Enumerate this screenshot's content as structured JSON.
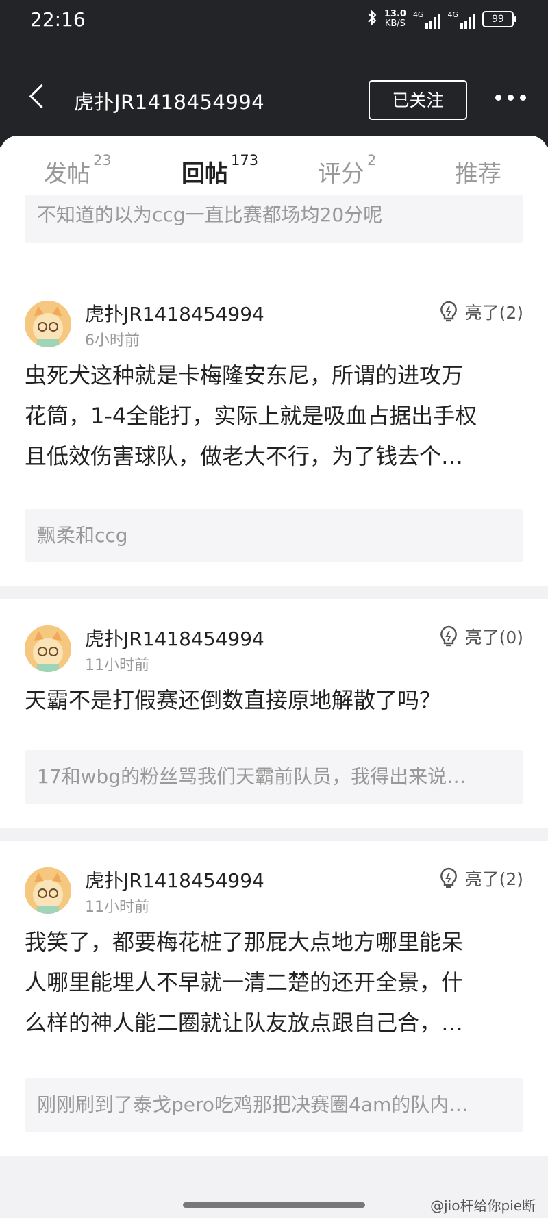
{
  "status": {
    "time": "22:16",
    "net_speed": "13.0",
    "net_unit": "KB/S",
    "signal1": "4G",
    "signal2": "4G",
    "battery": "99"
  },
  "nav": {
    "title": "虎扑JR1418454994",
    "follow_label": "已关注"
  },
  "tabs": [
    {
      "label": "发帖",
      "count": "23"
    },
    {
      "label": "回帖",
      "count": "173"
    },
    {
      "label": "评分",
      "count": "2"
    },
    {
      "label": "推荐",
      "count": ""
    }
  ],
  "top_quote": "不知道的以为ccg一直比赛都场均20分呢",
  "posts": [
    {
      "user": "虎扑JR1418454994",
      "time": "6小时前",
      "likes": "亮了(2)",
      "lines": [
        "虫死犬这种就是卡梅隆安东尼，所谓的进攻万",
        "花筒，1-4全能打，实际上就是吸血占据出手权",
        "且低效伤害球队，做老大不行，为了钱去个…"
      ],
      "quote": "飘柔和ccg"
    },
    {
      "user": "虎扑JR1418454994",
      "time": "11小时前",
      "likes": "亮了(0)",
      "lines": [
        "天霸不是打假赛还倒数直接原地解散了吗？"
      ],
      "quote": "17和wbg的粉丝骂我们天霸前队员，我得出来说…"
    },
    {
      "user": "虎扑JR1418454994",
      "time": "11小时前",
      "likes": "亮了(2)",
      "lines": [
        "我笑了，都要梅花桩了那屁大点地方哪里能呆",
        "人哪里能埋人不早就一清二楚的还开全景，什",
        "么样的神人能二圈就让队友放点跟自己合，…"
      ],
      "quote": "刚刚刷到了泰戈pero吃鸡那把决赛圈4am的队内…"
    }
  ],
  "watermark": "@jio杆给你pie断",
  "colors": {
    "topbar": "#222427",
    "accent": "#e8342a"
  }
}
